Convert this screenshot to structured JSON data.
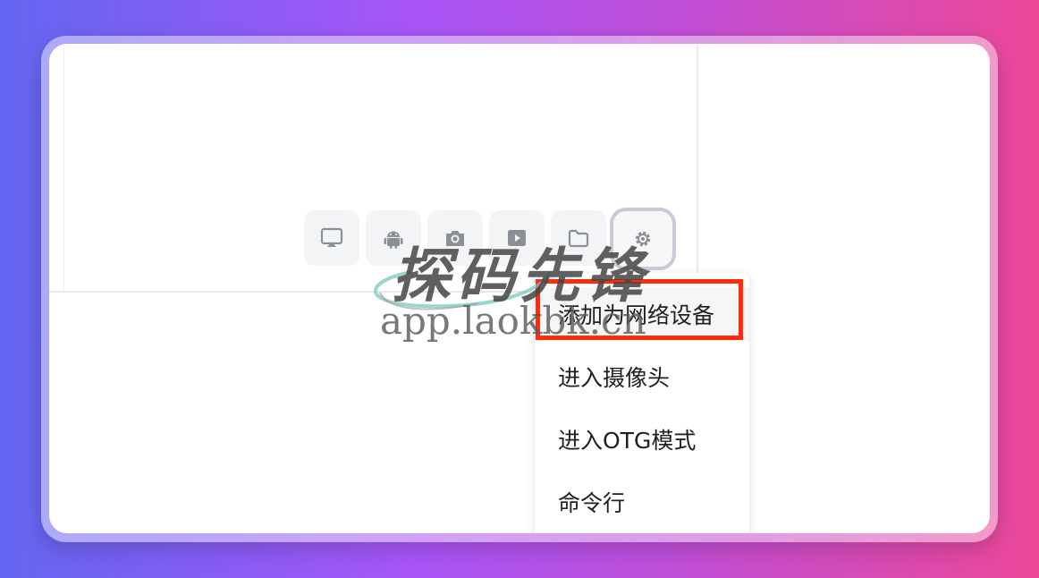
{
  "toolbar": {
    "buttons": [
      {
        "icon": "monitor-icon"
      },
      {
        "icon": "android-icon"
      },
      {
        "icon": "camera-icon"
      },
      {
        "icon": "video-icon"
      },
      {
        "icon": "folder-icon"
      },
      {
        "icon": "gear-icon",
        "active": true
      }
    ]
  },
  "menu": {
    "items": [
      {
        "label": "添加为网络设备"
      },
      {
        "label": "进入摄像头"
      },
      {
        "label": "进入OTG模式"
      },
      {
        "label": "命令行"
      }
    ]
  },
  "watermark": {
    "title": "探码先锋",
    "url": "app.laokbk.cn"
  },
  "colors": {
    "highlight": "#ff2b0a",
    "background_start": "#6366f1",
    "background_end": "#ec4899"
  }
}
